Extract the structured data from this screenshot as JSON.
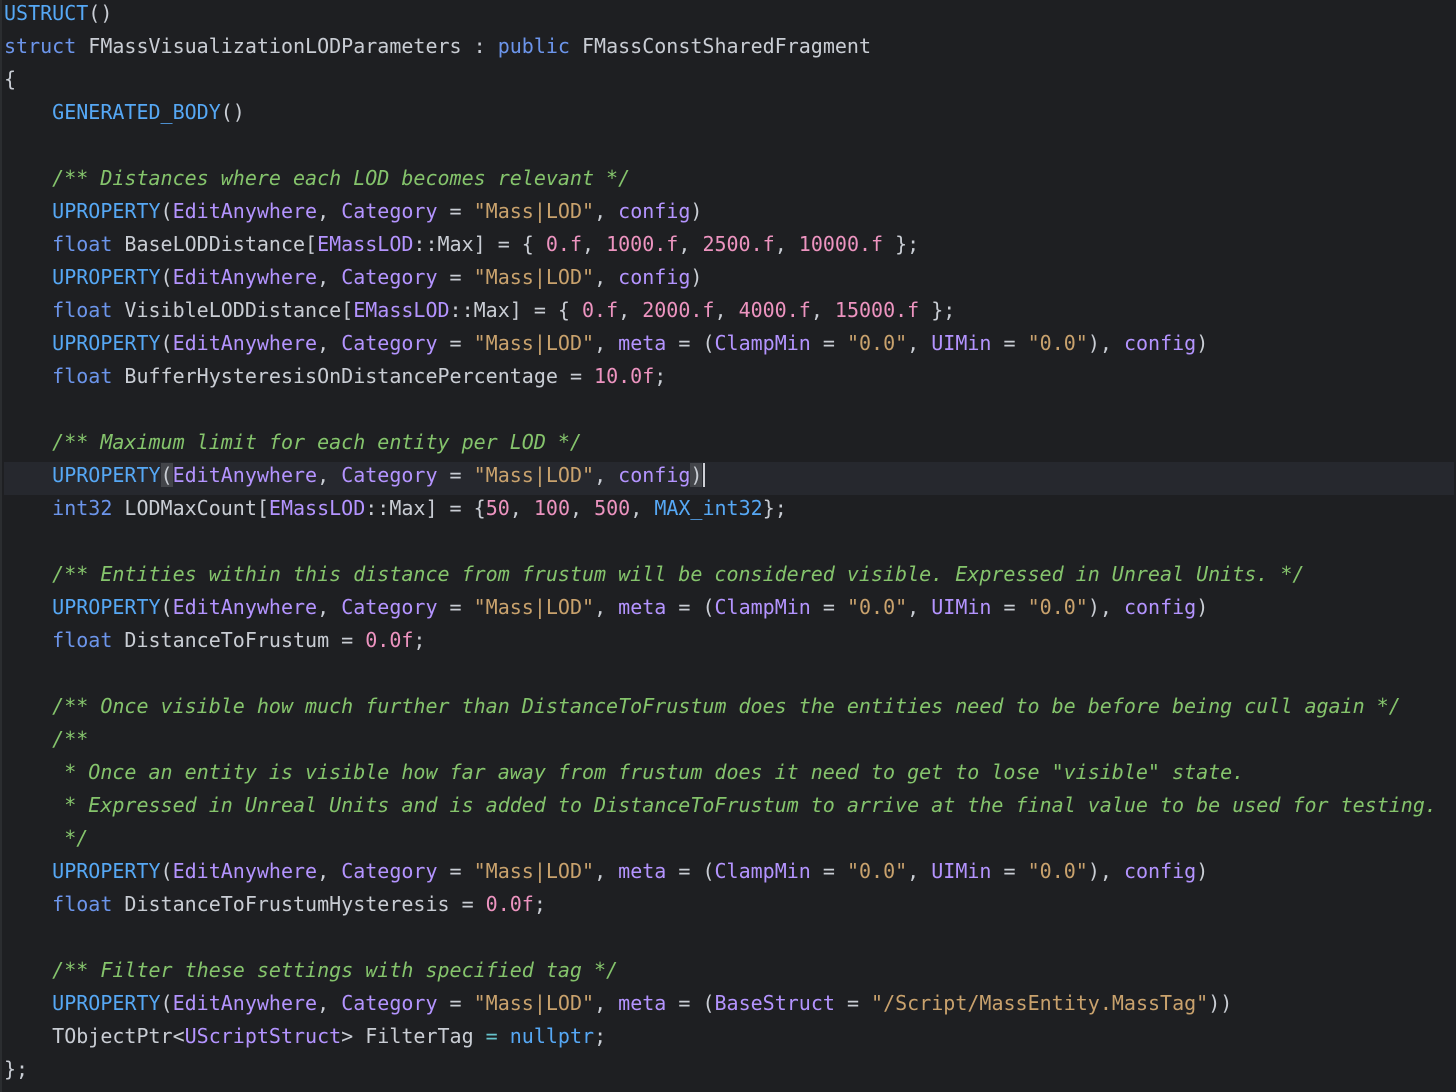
{
  "editor": {
    "lines": [
      [
        {
          "t": "USTRUCT",
          "c": "c-macro"
        },
        {
          "t": "()",
          "c": "c-ident"
        }
      ],
      [
        {
          "t": "struct ",
          "c": "c-keyword"
        },
        {
          "t": "FMassVisualizationLODParameters",
          "c": "c-ident"
        },
        {
          "t": " : ",
          "c": "c-ident"
        },
        {
          "t": "public ",
          "c": "c-keyword"
        },
        {
          "t": "FMassConstSharedFragment",
          "c": "c-ident"
        }
      ],
      [
        {
          "t": "{",
          "c": "c-ident"
        }
      ],
      [
        {
          "t": "    ",
          "c": "c-ident"
        },
        {
          "t": "GENERATED_BODY",
          "c": "c-macro"
        },
        {
          "t": "()",
          "c": "c-ident"
        }
      ],
      [],
      [
        {
          "t": "    ",
          "c": "c-ident"
        },
        {
          "t": "/** Distances where each LOD becomes relevant */",
          "c": "c-comment"
        }
      ],
      [
        {
          "t": "    ",
          "c": "c-ident"
        },
        {
          "t": "UPROPERTY",
          "c": "c-macro"
        },
        {
          "t": "(",
          "c": "c-ident"
        },
        {
          "t": "EditAnywhere",
          "c": "c-purple"
        },
        {
          "t": ", ",
          "c": "c-ident"
        },
        {
          "t": "Category",
          "c": "c-purple"
        },
        {
          "t": " = ",
          "c": "c-ident"
        },
        {
          "t": "\"Mass|LOD\"",
          "c": "c-string"
        },
        {
          "t": ", ",
          "c": "c-ident"
        },
        {
          "t": "config",
          "c": "c-purple"
        },
        {
          "t": ")",
          "c": "c-ident"
        }
      ],
      [
        {
          "t": "    ",
          "c": "c-ident"
        },
        {
          "t": "float ",
          "c": "c-keyword"
        },
        {
          "t": "BaseLODDistance[",
          "c": "c-ident"
        },
        {
          "t": "EMassLOD",
          "c": "c-purple"
        },
        {
          "t": "::",
          "c": "c-ident"
        },
        {
          "t": "Max",
          "c": "c-ident"
        },
        {
          "t": "] = { ",
          "c": "c-ident"
        },
        {
          "t": "0.f",
          "c": "c-number"
        },
        {
          "t": ", ",
          "c": "c-ident"
        },
        {
          "t": "1000.f",
          "c": "c-number"
        },
        {
          "t": ", ",
          "c": "c-ident"
        },
        {
          "t": "2500.f",
          "c": "c-number"
        },
        {
          "t": ", ",
          "c": "c-ident"
        },
        {
          "t": "10000.f",
          "c": "c-number"
        },
        {
          "t": " };",
          "c": "c-ident"
        }
      ],
      [
        {
          "t": "    ",
          "c": "c-ident"
        },
        {
          "t": "UPROPERTY",
          "c": "c-macro"
        },
        {
          "t": "(",
          "c": "c-ident"
        },
        {
          "t": "EditAnywhere",
          "c": "c-purple"
        },
        {
          "t": ", ",
          "c": "c-ident"
        },
        {
          "t": "Category",
          "c": "c-purple"
        },
        {
          "t": " = ",
          "c": "c-ident"
        },
        {
          "t": "\"Mass|LOD\"",
          "c": "c-string"
        },
        {
          "t": ", ",
          "c": "c-ident"
        },
        {
          "t": "config",
          "c": "c-purple"
        },
        {
          "t": ")",
          "c": "c-ident"
        }
      ],
      [
        {
          "t": "    ",
          "c": "c-ident"
        },
        {
          "t": "float ",
          "c": "c-keyword"
        },
        {
          "t": "VisibleLODDistance[",
          "c": "c-ident"
        },
        {
          "t": "EMassLOD",
          "c": "c-purple"
        },
        {
          "t": "::",
          "c": "c-ident"
        },
        {
          "t": "Max",
          "c": "c-ident"
        },
        {
          "t": "] = { ",
          "c": "c-ident"
        },
        {
          "t": "0.f",
          "c": "c-number"
        },
        {
          "t": ", ",
          "c": "c-ident"
        },
        {
          "t": "2000.f",
          "c": "c-number"
        },
        {
          "t": ", ",
          "c": "c-ident"
        },
        {
          "t": "4000.f",
          "c": "c-number"
        },
        {
          "t": ", ",
          "c": "c-ident"
        },
        {
          "t": "15000.f",
          "c": "c-number"
        },
        {
          "t": " };",
          "c": "c-ident"
        }
      ],
      [
        {
          "t": "    ",
          "c": "c-ident"
        },
        {
          "t": "UPROPERTY",
          "c": "c-macro"
        },
        {
          "t": "(",
          "c": "c-ident"
        },
        {
          "t": "EditAnywhere",
          "c": "c-purple"
        },
        {
          "t": ", ",
          "c": "c-ident"
        },
        {
          "t": "Category",
          "c": "c-purple"
        },
        {
          "t": " = ",
          "c": "c-ident"
        },
        {
          "t": "\"Mass|LOD\"",
          "c": "c-string"
        },
        {
          "t": ", ",
          "c": "c-ident"
        },
        {
          "t": "meta",
          "c": "c-purple"
        },
        {
          "t": " = (",
          "c": "c-ident"
        },
        {
          "t": "ClampMin",
          "c": "c-purple"
        },
        {
          "t": " = ",
          "c": "c-ident"
        },
        {
          "t": "\"0.0\"",
          "c": "c-string"
        },
        {
          "t": ", ",
          "c": "c-ident"
        },
        {
          "t": "UIMin",
          "c": "c-purple"
        },
        {
          "t": " = ",
          "c": "c-ident"
        },
        {
          "t": "\"0.0\"",
          "c": "c-string"
        },
        {
          "t": "), ",
          "c": "c-ident"
        },
        {
          "t": "config",
          "c": "c-purple"
        },
        {
          "t": ")",
          "c": "c-ident"
        }
      ],
      [
        {
          "t": "    ",
          "c": "c-ident"
        },
        {
          "t": "float ",
          "c": "c-keyword"
        },
        {
          "t": "BufferHysteresisOnDistancePercentage = ",
          "c": "c-ident"
        },
        {
          "t": "10.0f",
          "c": "c-number"
        },
        {
          "t": ";",
          "c": "c-ident"
        }
      ],
      [],
      [
        {
          "t": "    ",
          "c": "c-ident"
        },
        {
          "t": "/** Maximum limit for each entity per LOD */",
          "c": "c-comment"
        }
      ],
      [
        {
          "t": "    ",
          "c": "c-ident"
        },
        {
          "t": "UPROPERTY",
          "c": "c-macro"
        },
        {
          "t": "(",
          "c": "c-ident",
          "hl": true
        },
        {
          "t": "EditAnywhere",
          "c": "c-purple"
        },
        {
          "t": ", ",
          "c": "c-ident"
        },
        {
          "t": "Category",
          "c": "c-purple"
        },
        {
          "t": " = ",
          "c": "c-ident"
        },
        {
          "t": "\"Mass|LOD\"",
          "c": "c-string"
        },
        {
          "t": ", ",
          "c": "c-ident"
        },
        {
          "t": "config",
          "c": "c-purple"
        },
        {
          "t": ")",
          "c": "c-ident",
          "hl": true
        }
      ],
      [
        {
          "t": "    ",
          "c": "c-ident"
        },
        {
          "t": "int32 ",
          "c": "c-keyword"
        },
        {
          "t": "LODMaxCount[",
          "c": "c-ident"
        },
        {
          "t": "EMassLOD",
          "c": "c-purple"
        },
        {
          "t": "::",
          "c": "c-ident"
        },
        {
          "t": "Max",
          "c": "c-ident"
        },
        {
          "t": "] = {",
          "c": "c-ident"
        },
        {
          "t": "50",
          "c": "c-number"
        },
        {
          "t": ", ",
          "c": "c-ident"
        },
        {
          "t": "100",
          "c": "c-number"
        },
        {
          "t": ", ",
          "c": "c-ident"
        },
        {
          "t": "500",
          "c": "c-number"
        },
        {
          "t": ", ",
          "c": "c-ident"
        },
        {
          "t": "MAX_int32",
          "c": "c-macro"
        },
        {
          "t": "};",
          "c": "c-ident"
        }
      ],
      [],
      [
        {
          "t": "    ",
          "c": "c-ident"
        },
        {
          "t": "/** Entities within this distance from frustum will be considered visible. Expressed in Unreal Units. */",
          "c": "c-comment"
        }
      ],
      [
        {
          "t": "    ",
          "c": "c-ident"
        },
        {
          "t": "UPROPERTY",
          "c": "c-macro"
        },
        {
          "t": "(",
          "c": "c-ident"
        },
        {
          "t": "EditAnywhere",
          "c": "c-purple"
        },
        {
          "t": ", ",
          "c": "c-ident"
        },
        {
          "t": "Category",
          "c": "c-purple"
        },
        {
          "t": " = ",
          "c": "c-ident"
        },
        {
          "t": "\"Mass|LOD\"",
          "c": "c-string"
        },
        {
          "t": ", ",
          "c": "c-ident"
        },
        {
          "t": "meta",
          "c": "c-purple"
        },
        {
          "t": " = (",
          "c": "c-ident"
        },
        {
          "t": "ClampMin",
          "c": "c-purple"
        },
        {
          "t": " = ",
          "c": "c-ident"
        },
        {
          "t": "\"0.0\"",
          "c": "c-string"
        },
        {
          "t": ", ",
          "c": "c-ident"
        },
        {
          "t": "UIMin",
          "c": "c-purple"
        },
        {
          "t": " = ",
          "c": "c-ident"
        },
        {
          "t": "\"0.0\"",
          "c": "c-string"
        },
        {
          "t": "), ",
          "c": "c-ident"
        },
        {
          "t": "config",
          "c": "c-purple"
        },
        {
          "t": ")",
          "c": "c-ident"
        }
      ],
      [
        {
          "t": "    ",
          "c": "c-ident"
        },
        {
          "t": "float ",
          "c": "c-keyword"
        },
        {
          "t": "DistanceToFrustum = ",
          "c": "c-ident"
        },
        {
          "t": "0.0f",
          "c": "c-number"
        },
        {
          "t": ";",
          "c": "c-ident"
        }
      ],
      [],
      [
        {
          "t": "    ",
          "c": "c-ident"
        },
        {
          "t": "/** Once visible how much further than DistanceToFrustum does the entities need to be before being cull again */",
          "c": "c-comment"
        }
      ],
      [
        {
          "t": "    ",
          "c": "c-ident"
        },
        {
          "t": "/**",
          "c": "c-comment"
        }
      ],
      [
        {
          "t": "     ",
          "c": "c-ident"
        },
        {
          "t": "* Once an entity is visible how far away from frustum does it need to get to lose \"visible\" state.",
          "c": "c-comment"
        }
      ],
      [
        {
          "t": "     ",
          "c": "c-ident"
        },
        {
          "t": "* Expressed in Unreal Units and is added to DistanceToFrustum to arrive at the final value to be used for testing.",
          "c": "c-comment"
        }
      ],
      [
        {
          "t": "     ",
          "c": "c-ident"
        },
        {
          "t": "*/",
          "c": "c-comment"
        }
      ],
      [
        {
          "t": "    ",
          "c": "c-ident"
        },
        {
          "t": "UPROPERTY",
          "c": "c-macro"
        },
        {
          "t": "(",
          "c": "c-ident"
        },
        {
          "t": "EditAnywhere",
          "c": "c-purple"
        },
        {
          "t": ", ",
          "c": "c-ident"
        },
        {
          "t": "Category",
          "c": "c-purple"
        },
        {
          "t": " = ",
          "c": "c-ident"
        },
        {
          "t": "\"Mass|LOD\"",
          "c": "c-string"
        },
        {
          "t": ", ",
          "c": "c-ident"
        },
        {
          "t": "meta",
          "c": "c-purple"
        },
        {
          "t": " = (",
          "c": "c-ident"
        },
        {
          "t": "ClampMin",
          "c": "c-purple"
        },
        {
          "t": " = ",
          "c": "c-ident"
        },
        {
          "t": "\"0.0\"",
          "c": "c-string"
        },
        {
          "t": ", ",
          "c": "c-ident"
        },
        {
          "t": "UIMin",
          "c": "c-purple"
        },
        {
          "t": " = ",
          "c": "c-ident"
        },
        {
          "t": "\"0.0\"",
          "c": "c-string"
        },
        {
          "t": "), ",
          "c": "c-ident"
        },
        {
          "t": "config",
          "c": "c-purple"
        },
        {
          "t": ")",
          "c": "c-ident"
        }
      ],
      [
        {
          "t": "    ",
          "c": "c-ident"
        },
        {
          "t": "float ",
          "c": "c-keyword"
        },
        {
          "t": "DistanceToFrustumHysteresis = ",
          "c": "c-ident"
        },
        {
          "t": "0.0f",
          "c": "c-number"
        },
        {
          "t": ";",
          "c": "c-ident"
        }
      ],
      [],
      [
        {
          "t": "    ",
          "c": "c-ident"
        },
        {
          "t": "/** Filter these settings with specified tag */",
          "c": "c-comment"
        }
      ],
      [
        {
          "t": "    ",
          "c": "c-ident"
        },
        {
          "t": "UPROPERTY",
          "c": "c-macro"
        },
        {
          "t": "(",
          "c": "c-ident"
        },
        {
          "t": "EditAnywhere",
          "c": "c-purple"
        },
        {
          "t": ", ",
          "c": "c-ident"
        },
        {
          "t": "Category",
          "c": "c-purple"
        },
        {
          "t": " = ",
          "c": "c-ident"
        },
        {
          "t": "\"Mass|LOD\"",
          "c": "c-string"
        },
        {
          "t": ", ",
          "c": "c-ident"
        },
        {
          "t": "meta",
          "c": "c-purple"
        },
        {
          "t": " = (",
          "c": "c-ident"
        },
        {
          "t": "BaseStruct",
          "c": "c-purple"
        },
        {
          "t": " = ",
          "c": "c-ident"
        },
        {
          "t": "\"/Script/MassEntity.MassTag\"",
          "c": "c-string"
        },
        {
          "t": "))",
          "c": "c-ident"
        }
      ],
      [
        {
          "t": "    ",
          "c": "c-ident"
        },
        {
          "t": "TObjectPtr<",
          "c": "c-ident"
        },
        {
          "t": "UScriptStruct",
          "c": "c-purple"
        },
        {
          "t": "> ",
          "c": "c-ident"
        },
        {
          "t": "FilterTag",
          "c": "c-ident"
        },
        {
          "t": " = ",
          "c": "c-const"
        },
        {
          "t": "nullptr",
          "c": "c-macro"
        },
        {
          "t": ";",
          "c": "c-ident"
        }
      ],
      [
        {
          "t": "};",
          "c": "c-ident"
        }
      ]
    ],
    "current_line": 14,
    "caret_line": 14
  }
}
